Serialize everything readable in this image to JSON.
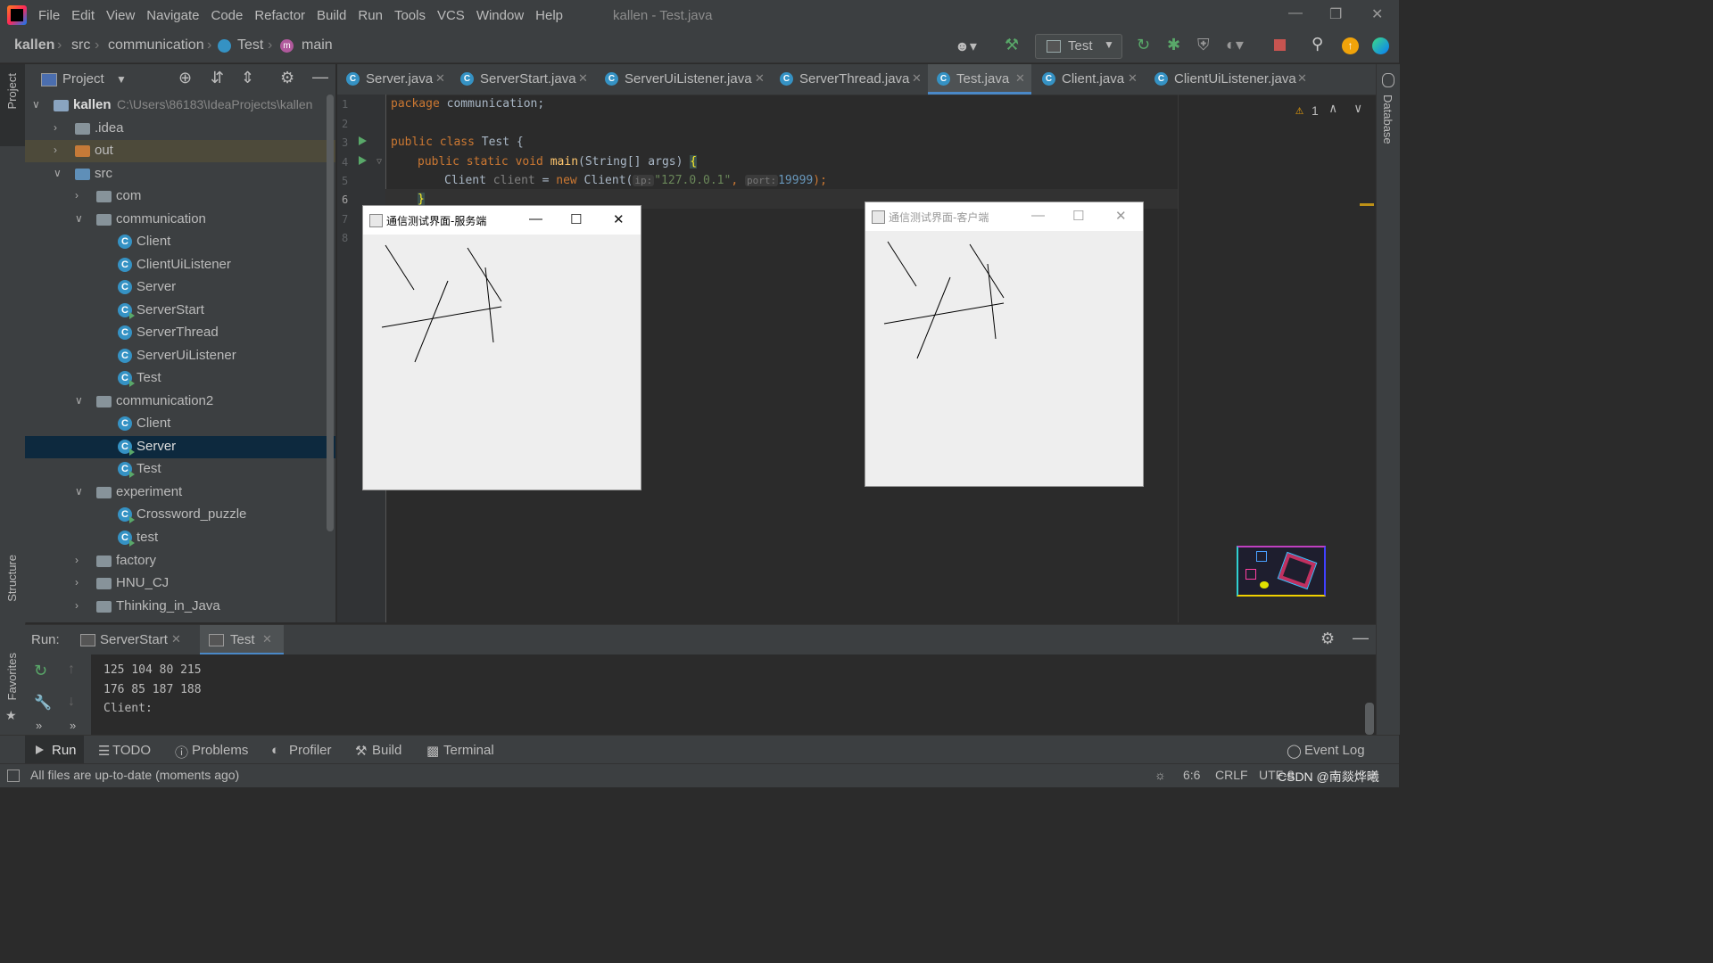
{
  "window": {
    "title": "kallen - Test.java"
  },
  "menu": [
    "File",
    "Edit",
    "View",
    "Navigate",
    "Code",
    "Refactor",
    "Build",
    "Run",
    "Tools",
    "VCS",
    "Window",
    "Help"
  ],
  "breadcrumb": {
    "project": "kallen",
    "src": "src",
    "package": "communication",
    "class": "Test",
    "method": "main"
  },
  "run_config": "Test",
  "project_panel": {
    "title": "Project",
    "root": {
      "name": "kallen",
      "path": "C:\\Users\\86183\\IdeaProjects\\kallen"
    },
    "items": [
      {
        "label": ".idea"
      },
      {
        "label": "out"
      },
      {
        "label": "src"
      },
      {
        "label": "com"
      },
      {
        "label": "communication"
      },
      {
        "label": "Client"
      },
      {
        "label": "ClientUiListener"
      },
      {
        "label": "Server"
      },
      {
        "label": "ServerStart"
      },
      {
        "label": "ServerThread"
      },
      {
        "label": "ServerUiListener"
      },
      {
        "label": "Test"
      },
      {
        "label": "communication2"
      },
      {
        "label": "Client"
      },
      {
        "label": "Server"
      },
      {
        "label": "Test"
      },
      {
        "label": "experiment"
      },
      {
        "label": "Crossword_puzzle"
      },
      {
        "label": "test"
      },
      {
        "label": "factory"
      },
      {
        "label": "HNU_CJ"
      },
      {
        "label": "Thinking_in_Java"
      }
    ]
  },
  "tabs": [
    {
      "label": "Server.java"
    },
    {
      "label": "ServerStart.java"
    },
    {
      "label": "ServerUiListener.java"
    },
    {
      "label": "ServerThread.java"
    },
    {
      "label": "Test.java"
    },
    {
      "label": "Client.java"
    },
    {
      "label": "ClientUiListener.java"
    }
  ],
  "editor": {
    "line_numbers": [
      "1",
      "2",
      "3",
      "4",
      "5",
      "6",
      "7",
      "8"
    ],
    "code": {
      "l1_kw": "package",
      "l1_rest": " communication;",
      "l3_kw": "public class",
      "l3_rest": " Test {",
      "l4_kw": "public static void",
      "l4_fn": "main",
      "l4_rest": "(String[] args) ",
      "l4_brace": "{",
      "l5_a": "Client ",
      "l5_var": "client",
      "l5_b": " = ",
      "l5_kw": "new",
      "l5_c": " Client(",
      "l5_hint_ip": "ip:",
      "l5_str": "\"127.0.0.1\"",
      "l5_d": ", ",
      "l5_hint_port": "port:",
      "l5_num": "19999",
      "l5_e": ");",
      "l6": "}"
    },
    "warnings_count": "1"
  },
  "server_window": {
    "title": "通信测试界面-服务端"
  },
  "client_window": {
    "title": "通信测试界面-客户端"
  },
  "side_labels": {
    "project": "Project",
    "structure": "Structure",
    "favorites": "Favorites",
    "database": "Database"
  },
  "run_panel": {
    "label": "Run:",
    "tabs": [
      {
        "label": "ServerStart"
      },
      {
        "label": "Test"
      }
    ],
    "console": [
      "125 104 80 215",
      "176 85 187 188",
      "Client:"
    ]
  },
  "tool_windows": [
    "Run",
    "TODO",
    "Problems",
    "Profiler",
    "Build",
    "Terminal"
  ],
  "event_log": "Event Log",
  "status": {
    "message": "All files are up-to-date (moments ago)",
    "position": "6:6",
    "line_sep": "CRLF",
    "encoding": "UTF-8",
    "watermark": "CSDN @南燚烨曦"
  },
  "colors": {
    "accent": "#4a88c7",
    "class_icon": "#3592c4",
    "run_green": "#59a869",
    "stop_red": "#c75450"
  }
}
